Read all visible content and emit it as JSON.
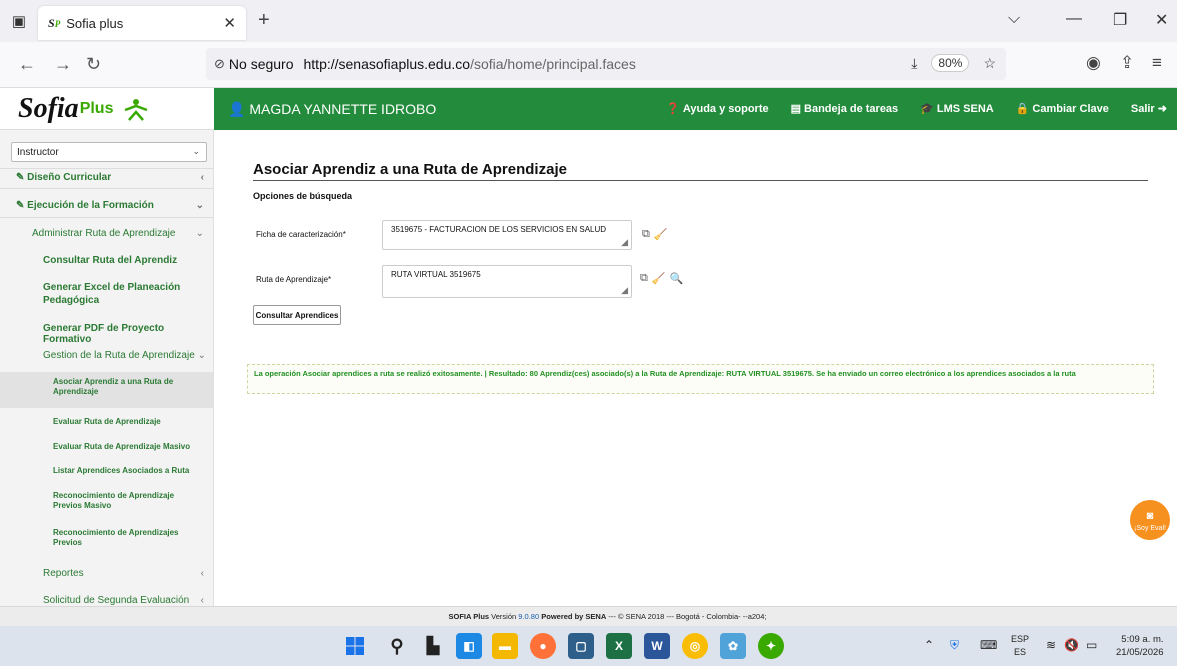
{
  "browser": {
    "tab_title": "Sofia plus",
    "tab_favicon": "S",
    "tab_favicon_small": "P",
    "not_secure": "No seguro",
    "url_host": "http://senasofiaplus.edu.co",
    "url_path": "/sofia/home/principal.faces",
    "zoom": "80%"
  },
  "header": {
    "logo_main": "Sofia",
    "logo_plus": "Plus",
    "user": "MAGDA YANNETTE IDROBO",
    "links": [
      "Ayuda y soporte",
      "Bandeja de tareas",
      "LMS SENA",
      "Cambiar Clave",
      "Salir"
    ]
  },
  "sidebar": {
    "role": "Instructor",
    "items": [
      {
        "label": "Diseño Curricular"
      },
      {
        "label": "Ejecución de la Formación"
      },
      {
        "label": "Administrar Ruta de Aprendizaje"
      },
      {
        "label": "Consultar Ruta del Aprendiz"
      },
      {
        "label": "Generar Excel de Planeación Pedagógica"
      },
      {
        "label": "Generar PDF de Proyecto Formativo"
      },
      {
        "label": "Gestion de la Ruta de Aprendizaje"
      },
      {
        "label": "Asociar Aprendiz a una Ruta de Aprendizaje"
      },
      {
        "label": "Evaluar Ruta de Aprendizaje"
      },
      {
        "label": "Evaluar Ruta de Aprendizaje Masivo"
      },
      {
        "label": "Listar Aprendices Asociados a Ruta"
      },
      {
        "label": "Reconocimiento de Aprendizaje Previos Masivo"
      },
      {
        "label": "Reconocimiento de Aprendizajes Previos"
      },
      {
        "label": "Reportes"
      },
      {
        "label": "Solicitud de Segunda Evaluación"
      }
    ]
  },
  "main": {
    "title": "Asociar Aprendiz a una Ruta de Aprendizaje",
    "search_options": "Opciones de búsqueda",
    "ficha_label": "Ficha de caracterización*",
    "ficha_value": "3519675 - FACTURACION DE LOS SERVICIOS EN SALUD",
    "ruta_label": "Ruta de Aprendizaje*",
    "ruta_value": "RUTA VIRTUAL 3519675",
    "button": "Consultar Aprendices",
    "message": "La operación Asociar aprendices a ruta se realizó exitosamente. | Resultado: 80 Aprendiz(ces) asociado(s) a la Ruta de Aprendizaje: RUTA VIRTUAL 3519675. Se ha enviado un correo electrónico a los aprendices asociados a la ruta"
  },
  "eval_bubble": "¡Soy Eval!",
  "footer": {
    "app": "SOFIA Plus",
    "version_label": "Versión",
    "version": "9.0.80",
    "powered": "Powered by SENA",
    "rest": "--- © SENA 2018 --- Bogotá - Colombia- --a204;"
  },
  "taskbar": {
    "lang_top": "ESP",
    "lang_bottom": "ES",
    "time": "5:09 a. m.",
    "date": "21/05/2026"
  },
  "colors": {
    "brand_green": "#238b3c",
    "link_green": "#2b7a34",
    "success_green": "#229022",
    "accent_orange": "#f6901e"
  }
}
